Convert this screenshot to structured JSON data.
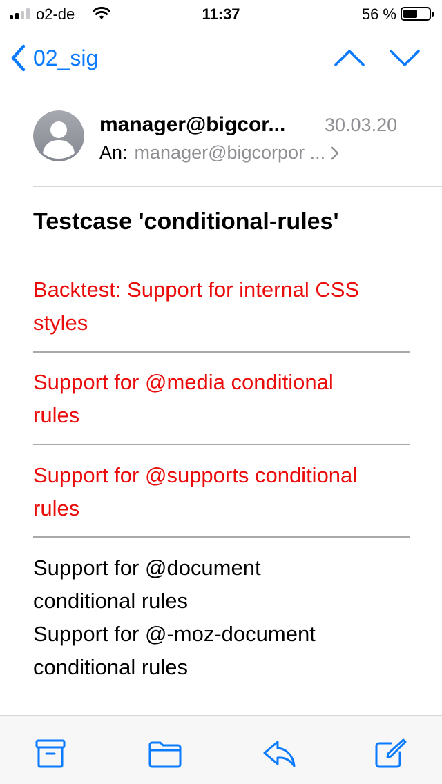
{
  "status_bar": {
    "carrier": "o2-de",
    "time": "11:37",
    "battery_percent": "56 %",
    "battery_level": 0.56
  },
  "nav": {
    "back_label": "02_sig",
    "accent_color": "#0a7aff"
  },
  "message": {
    "sender": "manager@bigcor...",
    "date": "30.03.20",
    "to_label": "An:",
    "to_address": "manager@bigcorpor ..."
  },
  "body": {
    "subject": "Testcase 'conditional-rules'",
    "failing_color": "#ea0b0b",
    "failing_items": [
      {
        "line1": "Backtest: Support for internal CSS",
        "line2": "styles"
      },
      {
        "line1": "Support for @media conditional",
        "line2": "rules"
      },
      {
        "line1": "Support for @supports conditional",
        "line2": "rules"
      }
    ],
    "passing_lines": [
      "Support for @document",
      "conditional rules",
      "Support for @-moz-document",
      "conditional rules"
    ]
  },
  "toolbar": {
    "icons": [
      "archive-icon",
      "folder-icon",
      "reply-icon",
      "compose-icon"
    ]
  }
}
